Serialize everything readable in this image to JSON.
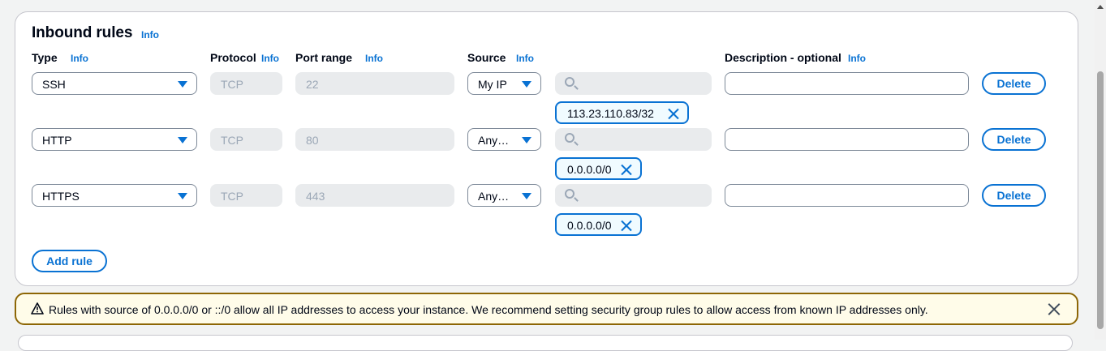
{
  "section": {
    "title": "Inbound rules",
    "info": "Info"
  },
  "headers": {
    "type": "Type",
    "protocol": "Protocol",
    "port_range": "Port range",
    "source": "Source",
    "description": "Description - optional",
    "info": "Info"
  },
  "rules": [
    {
      "type": "SSH",
      "protocol": "TCP",
      "port": "22",
      "source": "My IP",
      "cidr": "113.23.110.83/32",
      "delete": "Delete"
    },
    {
      "type": "HTTP",
      "protocol": "TCP",
      "port": "80",
      "source": "Any…",
      "cidr": "0.0.0.0/0",
      "delete": "Delete"
    },
    {
      "type": "HTTPS",
      "protocol": "TCP",
      "port": "443",
      "source": "Any…",
      "cidr": "0.0.0.0/0",
      "delete": "Delete"
    }
  ],
  "add_rule": "Add rule",
  "alert": {
    "message": "Rules with source of 0.0.0.0/0 or ::/0 allow all IP addresses to access your instance. We recommend setting security group rules to allow access from known IP addresses only."
  },
  "icons": {
    "caret": "caret-down-icon",
    "search": "search-icon",
    "remove": "close-icon",
    "warning": "warning-icon"
  },
  "colors": {
    "accent": "#0972d3",
    "warning_border": "#8d6605",
    "warning_bg": "#fffce9"
  }
}
